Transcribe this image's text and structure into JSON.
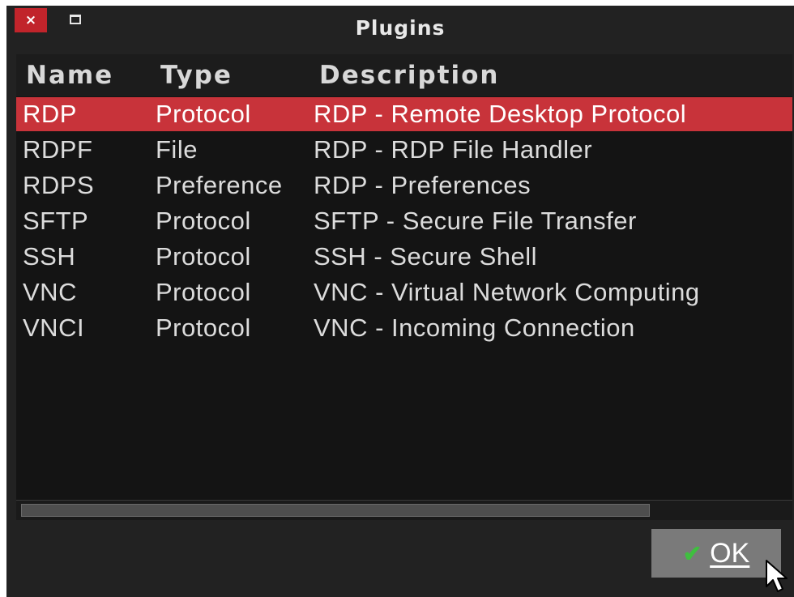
{
  "window": {
    "title": "Plugins",
    "close_glyph": "×"
  },
  "table": {
    "columns": [
      "Name",
      "Type",
      "Description"
    ],
    "rows": [
      {
        "name": "RDP",
        "type": "Protocol",
        "description": "RDP - Remote Desktop Protocol",
        "selected": true
      },
      {
        "name": "RDPF",
        "type": "File",
        "description": "RDP - RDP File Handler"
      },
      {
        "name": "RDPS",
        "type": "Preference",
        "description": "RDP - Preferences"
      },
      {
        "name": "SFTP",
        "type": "Protocol",
        "description": "SFTP - Secure File Transfer"
      },
      {
        "name": "SSH",
        "type": "Protocol",
        "description": "SSH - Secure Shell"
      },
      {
        "name": "VNC",
        "type": "Protocol",
        "description": "VNC - Virtual Network Computing"
      },
      {
        "name": "VNCI",
        "type": "Protocol",
        "description": "VNC - Incoming Connection"
      }
    ]
  },
  "footer": {
    "ok_label": "OK",
    "ok_icon": "check-icon"
  },
  "colors": {
    "selection": "#c8333a",
    "close_button": "#c1242b",
    "background": "#222222"
  }
}
